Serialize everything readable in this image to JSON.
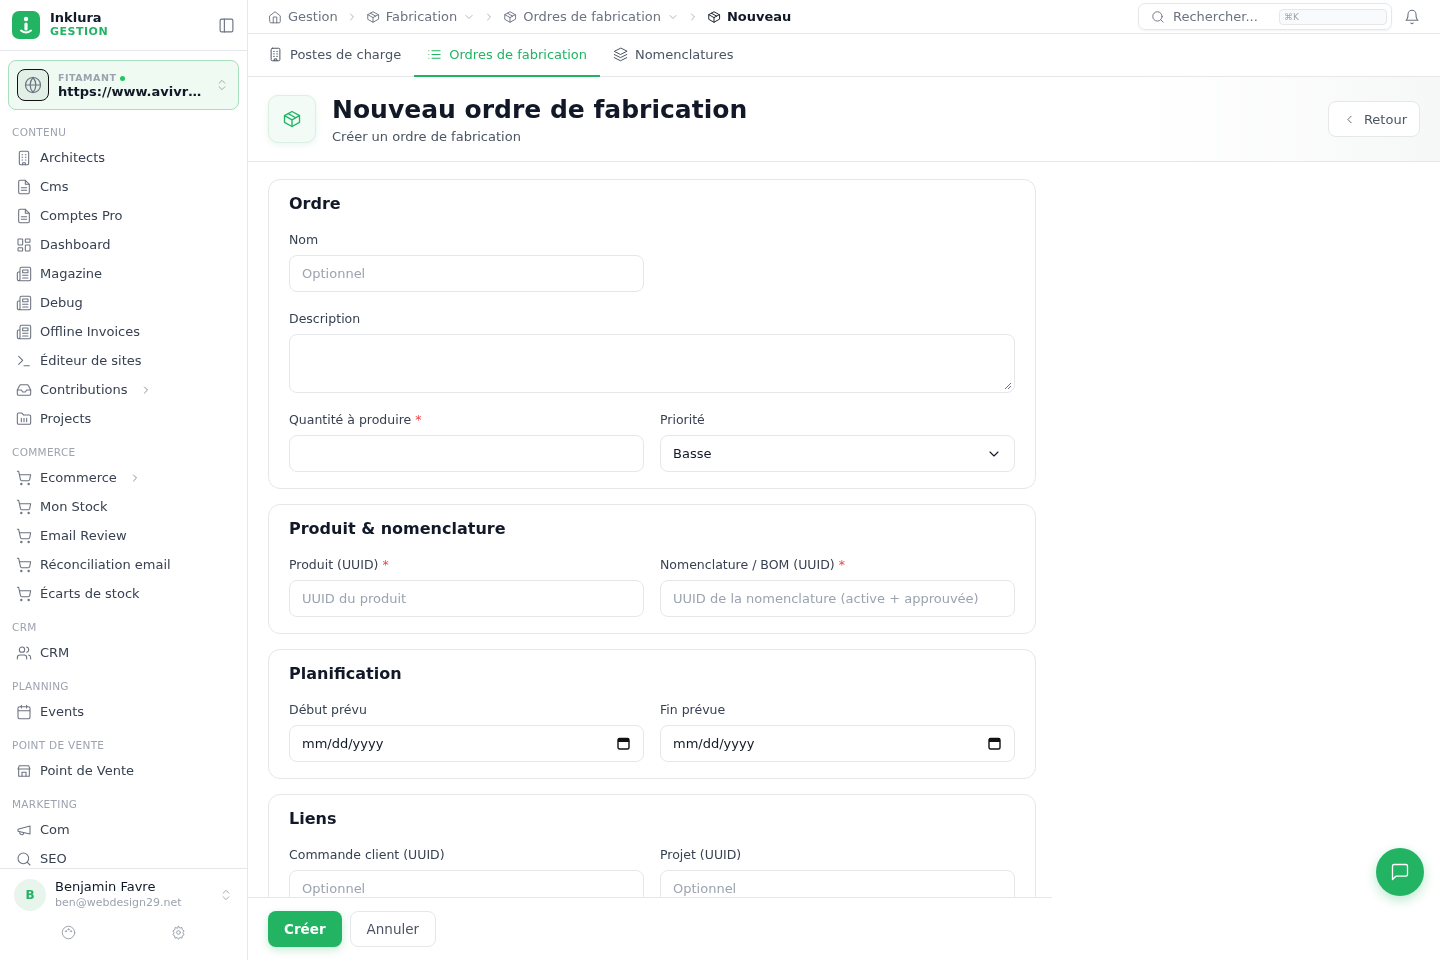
{
  "brand": {
    "name": "Inklura",
    "tagline": "GESTION"
  },
  "site_switcher": {
    "label": "FITAMANT",
    "online": true,
    "url": "https://www.avivr…"
  },
  "sidebar": {
    "sections": [
      {
        "title": "CONTENU",
        "items": [
          {
            "label": "Architects",
            "has_submenu": false
          },
          {
            "label": "Cms",
            "has_submenu": false
          },
          {
            "label": "Comptes Pro",
            "has_submenu": false
          },
          {
            "label": "Dashboard",
            "has_submenu": false
          },
          {
            "label": "Magazine",
            "has_submenu": false
          },
          {
            "label": "Debug",
            "has_submenu": false
          },
          {
            "label": "Offline Invoices",
            "has_submenu": false
          },
          {
            "label": "Éditeur de sites",
            "has_submenu": false
          },
          {
            "label": "Contributions",
            "has_submenu": true
          },
          {
            "label": "Projects",
            "has_submenu": false
          }
        ]
      },
      {
        "title": "COMMERCE",
        "items": [
          {
            "label": "Ecommerce",
            "has_submenu": true
          },
          {
            "label": "Mon Stock",
            "has_submenu": false
          },
          {
            "label": "Email Review",
            "has_submenu": false
          },
          {
            "label": "Réconciliation email",
            "has_submenu": false
          },
          {
            "label": "Écarts de stock",
            "has_submenu": false
          }
        ]
      },
      {
        "title": "CRM",
        "items": [
          {
            "label": "CRM",
            "has_submenu": false
          }
        ]
      },
      {
        "title": "PLANNING",
        "items": [
          {
            "label": "Events",
            "has_submenu": false
          }
        ]
      },
      {
        "title": "POINT DE VENTE",
        "items": [
          {
            "label": "Point de Vente",
            "has_submenu": false
          }
        ]
      },
      {
        "title": "MARKETING",
        "items": [
          {
            "label": "Com",
            "has_submenu": false
          },
          {
            "label": "SEO",
            "has_submenu": false
          }
        ]
      }
    ]
  },
  "user": {
    "initial": "B",
    "name": "Benjamin Favre",
    "email": "ben@webdesign29.net"
  },
  "breadcrumb": [
    {
      "label": "Gestion",
      "dropdown": false,
      "current": false
    },
    {
      "label": "Fabrication",
      "dropdown": true,
      "current": false
    },
    {
      "label": "Ordres de fabrication",
      "dropdown": true,
      "current": false
    },
    {
      "label": "Nouveau",
      "dropdown": false,
      "current": true
    }
  ],
  "search": {
    "placeholder": "Rechercher...",
    "shortcut": "⌘K"
  },
  "tabs": [
    {
      "label": "Postes de charge",
      "selected": false
    },
    {
      "label": "Ordres de fabrication",
      "selected": true
    },
    {
      "label": "Nomenclatures",
      "selected": false
    }
  ],
  "page": {
    "title": "Nouveau ordre de fabrication",
    "subtitle": "Créer un ordre de fabrication",
    "back_button": "Retour"
  },
  "sections": [
    {
      "title": "Ordre",
      "rows": [
        [
          {
            "label": "Nom",
            "kind": "text",
            "placeholder": "Optionnel"
          }
        ],
        [
          {
            "label": "Description",
            "kind": "textarea"
          }
        ],
        [
          {
            "label": "Quantité à produire",
            "kind": "text",
            "required_mark": "*"
          },
          {
            "label": "Priorité",
            "kind": "select",
            "value": "Basse"
          }
        ]
      ]
    },
    {
      "title": "Produit & nomenclature",
      "rows": [
        [
          {
            "label": "Produit (UUID)",
            "kind": "text",
            "required_mark": "*",
            "placeholder": "UUID du produit"
          },
          {
            "label": "Nomenclature / BOM (UUID)",
            "kind": "text",
            "required_mark": "*",
            "placeholder": "UUID de la nomenclature (active + approuvée)"
          }
        ]
      ]
    },
    {
      "title": "Planification",
      "rows": [
        [
          {
            "label": "Début prévu",
            "kind": "date",
            "placeholder": "mm/dd/yyyy"
          },
          {
            "label": "Fin prévue",
            "kind": "date",
            "placeholder": "mm/dd/yyyy"
          }
        ]
      ]
    },
    {
      "title": "Liens",
      "rows": [
        [
          {
            "label": "Commande client (UUID)",
            "kind": "text",
            "placeholder": "Optionnel"
          },
          {
            "label": "Projet (UUID)",
            "kind": "text",
            "placeholder": "Optionnel"
          }
        ]
      ]
    }
  ],
  "actions": [
    {
      "label": "Créer",
      "kind": "primary"
    },
    {
      "label": "Annuler",
      "kind": "secondary"
    }
  ]
}
